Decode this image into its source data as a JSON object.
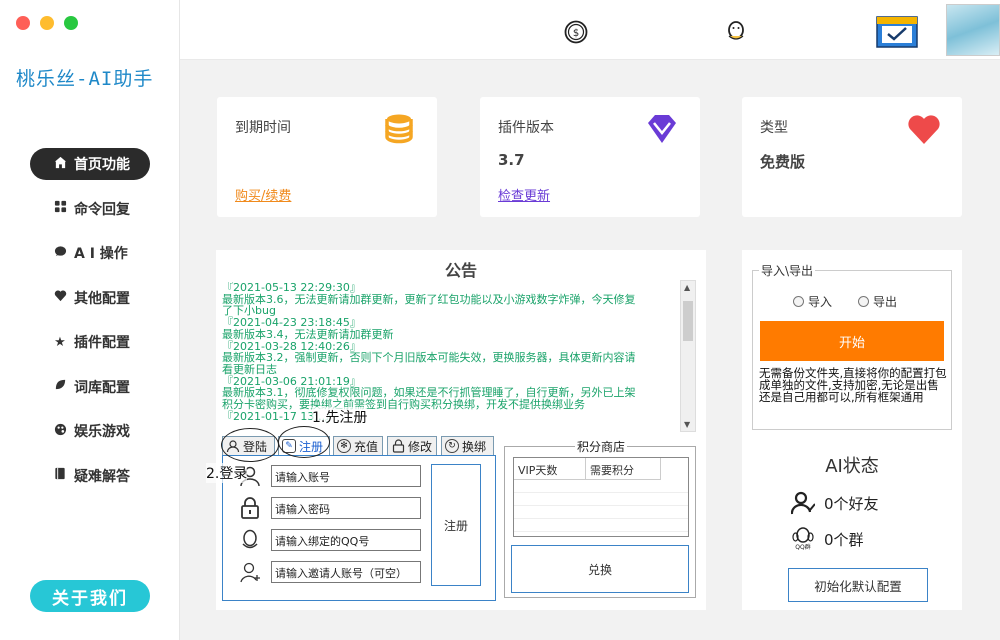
{
  "app": {
    "title": "桃乐丝-AI助手"
  },
  "window_controls": {
    "close_color": "#fe5f57",
    "minimize_color": "#febc2e",
    "maximize_color": "#28c840"
  },
  "sidebar": {
    "items": [
      {
        "label": "首页功能",
        "icon": "home-icon",
        "active": true
      },
      {
        "label": "命令回复",
        "icon": "grid-icon",
        "active": false
      },
      {
        "label": "A I 操作",
        "icon": "chat-icon",
        "active": false
      },
      {
        "label": "其他配置",
        "icon": "heart-icon",
        "active": false
      },
      {
        "label": "插件配置",
        "icon": "star-icon",
        "active": false
      },
      {
        "label": "词库配置",
        "icon": "leaf-icon",
        "active": false
      },
      {
        "label": "娱乐游戏",
        "icon": "palette-icon",
        "active": false
      },
      {
        "label": "疑难解答",
        "icon": "book-icon",
        "active": false
      }
    ],
    "about_label": "关于我们",
    "about_color": "#27c7d6"
  },
  "topbar": {
    "icons": [
      "coin-icon",
      "qq-penguin-icon",
      "calendar-check-icon",
      "user-avatar"
    ]
  },
  "cards": [
    {
      "label": "到期时间",
      "link": "购买/续费",
      "link_color": "#f08a1c",
      "icon": "coins-stack-icon"
    },
    {
      "label": "插件版本",
      "value": "3.7",
      "link": "检查更新",
      "link_color": "#6a3bd6",
      "icon": "diamond-icon"
    },
    {
      "label": "类型",
      "value": "免费版",
      "icon": "heart-icon"
    }
  ],
  "notice": {
    "title": "公告",
    "lines": [
      "『2021-05-13 22:29:30』",
      "最新版本3.6，无法更新请加群更新，更新了红包功能以及小游戏数字炸弹，今天修复",
      "了下小bug",
      "『2021-04-23 23:18:45』",
      "最新版本3.4，无法更新请加群更新",
      "『2021-03-28 12:40:26』",
      "最新版本3.2，强制更新，否则下个月旧版本可能失效，更换服务器，具体更新内容请",
      "看更新日志",
      "『2021-03-06 21:01:19』",
      "最新版本3.1，彻底修复权限问题，如果还是不行抓管理睡了，自行更新，另外已上架",
      "积分卡密购买，要换绑之前需签到自行购买积分换绑，开发不提供换绑业务",
      "『2021-01-17 13:..』"
    ],
    "text_color": "#1aa36a"
  },
  "tabs": [
    {
      "label": "登陆",
      "icon": "user-icon"
    },
    {
      "label": "注册",
      "icon": "edit-icon",
      "active": true
    },
    {
      "label": "充值",
      "icon": "gear-icon"
    },
    {
      "label": "修改",
      "icon": "lock-icon"
    },
    {
      "label": "换绑",
      "icon": "refresh-icon"
    }
  ],
  "register_form": {
    "account_placeholder": "请输入账号",
    "password_placeholder": "请输入密码",
    "qq_placeholder": "请输入绑定的QQ号",
    "inviter_placeholder": "请输入邀请人账号（可空）",
    "submit_label": "注册"
  },
  "shop": {
    "title": "积分商店",
    "columns": [
      "VIP天数",
      "需要积分"
    ],
    "redeem_label": "兑换"
  },
  "annotations": {
    "step1": "1.先注册",
    "step2": "2.登录"
  },
  "import_export": {
    "title": "导入\\导出",
    "option_import": "导入",
    "option_export": "导出",
    "start_label": "开始",
    "start_color": "#ff7b00",
    "description": "无需备份文件夹,直接将你的配置打包成单独的文件,支持加密,无论是出售还是自己用都可以,所有框架通用"
  },
  "ai_status": {
    "title": "AI状态",
    "friends": "0个好友",
    "groups": "0个群",
    "group_badge": "QQ群",
    "init_label": "初始化默认配置"
  }
}
